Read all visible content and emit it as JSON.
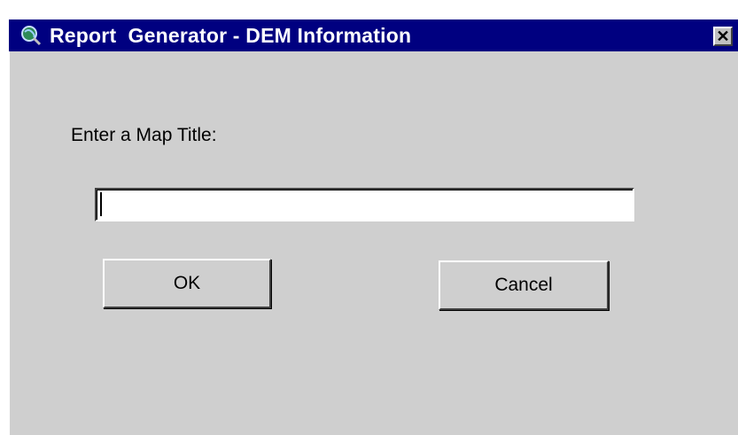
{
  "window": {
    "title": "Report  Generator - DEM Information",
    "close_label": "✕"
  },
  "dialog": {
    "prompt_label": "Enter a Map Title:",
    "title_input_value": "",
    "ok_label": "OK",
    "cancel_label": "Cancel"
  },
  "colors": {
    "titlebar": "#000080",
    "window_bg": "#cfcfcf"
  },
  "icons": {
    "app": "globe-magnifier-icon",
    "close": "close-icon"
  }
}
